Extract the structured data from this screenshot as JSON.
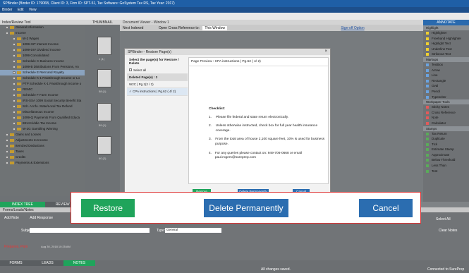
{
  "window": {
    "title": "SPBinder (Binder ID: 17906B, Client ID: 3, Firm ID: SPT-51, Tax Software: GoSystem Tax RS, Tax Year: 2017)"
  },
  "menu": [
    "Binder",
    "Edit",
    "View"
  ],
  "left_pane": {
    "title": "Index/Review Tool",
    "items": [
      "General Information",
      "Income",
      "W-2 Wages",
      "1099-INT Interest Income",
      "1099-DIV Dividend Income",
      "1099 Consolidated",
      "Schedule C Business Income",
      "1099-B  Distributions From Pensions, An",
      "Schedule E  Rent and Royalty",
      "Schedule K-1 Passthrough Income or Lo",
      "PTP Schedule K-1 Passthrough Income o",
      "REMIC",
      "Schedule F Farm Income",
      "IRS-SSA 1099 Social Security Benefit Sta",
      "Sch. A Info. State/Local Tax Refund",
      "Miscellaneous Income",
      "1099-Q Payments From Qualified Educa",
      "8814 Kiddie Tax Income",
      "W-2G Gambling Winning",
      "Gains and Losses",
      "Adjustments to Income",
      "Itemized Deductions",
      "Taxes",
      "Credits",
      "Payments & Extensions"
    ],
    "tabs": [
      "INDEX TREE",
      "REVIEW TREE"
    ]
  },
  "thumbs": {
    "title": "THUMBNAIL",
    "labels": [
      "1 (1)",
      "58 (1)",
      "59 (1)",
      "60 (2)"
    ]
  },
  "doc": {
    "tab": "Document Viewer - Window 1",
    "tool_text": "Open Cross Reference to:",
    "tool_value": "This Window",
    "next_indexed": "Next Indexed",
    "signoff": "Sign-off Option"
  },
  "dialog": {
    "title": "SPBinder - Restore Page(s)",
    "select_label": "Select the page(s) for Restore / Delete",
    "select_all": "Select all",
    "deleted_header": "Deleted Page(s) : 2",
    "deleted_rows": [
      "W2C | Pg.1(2 / 2)",
      "CPA instructions | Pg.62 ( 4/ 2)"
    ],
    "preview_title": "Page Preview : CPA instructions | Pg.62 ( 4/ 2)",
    "checklist_title": "Checklist:",
    "checklist": [
      "Please file federal and state return electronically.",
      "Unless otherwise instructed, check box for full year health insurance coverage.",
      "From the total area of house 2,100 square feet, 10% is used for business purpose.",
      "For any queries please contact on: 949-706-0668 or email paul.rogers@sureprep.com"
    ],
    "buttons": {
      "restore": "Restore",
      "delete": "Delete Permanently",
      "cancel": "Cancel"
    }
  },
  "magnified": {
    "restore": "Restore",
    "delete": "Delete Permanently",
    "cancel": "Cancel"
  },
  "right_pane": {
    "title": "ANNOTATE",
    "sections": [
      {
        "name": "Highlight",
        "items": [
          "Highlighter",
          "Freehand Highlighter",
          "Highlight Text",
          "Underline Text",
          "Strikeout Text"
        ]
      },
      {
        "name": "Markups",
        "items": [
          "TextBox",
          "Arrow",
          "Line",
          "Rectangle",
          "Oval",
          "Pencil",
          "Typewriter"
        ]
      },
      {
        "name": "Workpaper Tools",
        "items": [
          "Sticky Notes",
          "Cross Reference",
          "Note",
          "Calculator"
        ]
      },
      {
        "name": "Stamps",
        "items": [
          "Tax Return",
          "Duplicate",
          "Tick",
          "Estimate Stamp",
          "Approximate",
          "Below Threshold",
          "Less Than",
          "Test"
        ]
      }
    ]
  },
  "notes": {
    "title": "Forms/Leads/Notes",
    "add_note": "Add Note",
    "add_response": "Add Response",
    "subject_label": "Subject:",
    "type_label": "Type:",
    "type_value": "General",
    "select_all": "Select All",
    "clear_notes": "Clear Notes",
    "author": "Prepares, Pam",
    "date": "Aug 30, 2018 10:25 AM"
  },
  "footer": {
    "tabs": [
      "FORMS",
      "LEADS",
      "NOTES"
    ],
    "status": "All changes saved.",
    "connection": "Connected to SurePrep"
  },
  "colors": {
    "green": "#1fa45b",
    "blue": "#2b6db0",
    "title_blue": "#1f5fa6"
  }
}
